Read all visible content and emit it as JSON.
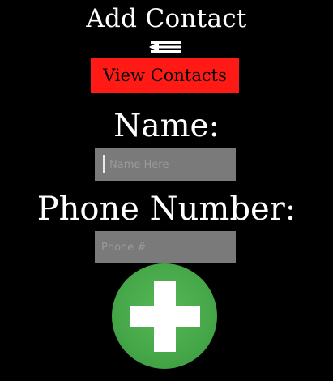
{
  "header": {
    "title": "Add Contact"
  },
  "nav": {
    "back_icon": "back-arrow-icon",
    "view_contacts_label": "View Contacts"
  },
  "form": {
    "name_label": "Name:",
    "name_placeholder": "Name Here",
    "phone_label": "Phone Number:",
    "phone_placeholder": "Phone #"
  },
  "actions": {
    "add_icon": "plus-icon"
  },
  "colors": {
    "background": "#000000",
    "view_button": "#ff1a16",
    "input_background": "#7a7a7a",
    "add_button": "#45a748",
    "text": "#ffffff"
  }
}
